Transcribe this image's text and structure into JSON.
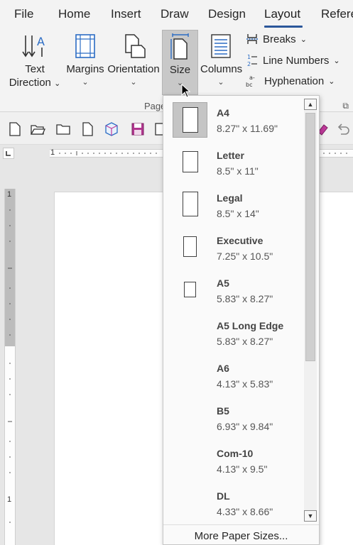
{
  "tabs": [
    {
      "label": "File"
    },
    {
      "label": "Home"
    },
    {
      "label": "Insert"
    },
    {
      "label": "Draw"
    },
    {
      "label": "Design"
    },
    {
      "label": "Layout",
      "active": true
    },
    {
      "label": "Refere"
    }
  ],
  "ribbon": {
    "text_direction": {
      "line1": "Text",
      "line2": "Direction"
    },
    "margins": "Margins",
    "orientation": "Orientation",
    "size": "Size",
    "columns": "Columns",
    "breaks": "Breaks",
    "line_numbers": "Line Numbers",
    "hyphenation": "Hyphenation",
    "group_label": "Page",
    "chevron": "⌄"
  },
  "ruler": {
    "h_mark": "1",
    "v_marks": [
      "1",
      "1"
    ]
  },
  "size_menu": {
    "items": [
      {
        "name": "A4",
        "dims": "8.27\" x 11.69\"",
        "selected": true
      },
      {
        "name": "Letter",
        "dims": "8.5\" x 11\""
      },
      {
        "name": "Legal",
        "dims": "8.5\" x 14\""
      },
      {
        "name": "Executive",
        "dims": "7.25\" x 10.5\""
      },
      {
        "name": "A5",
        "dims": "5.83\" x 8.27\""
      },
      {
        "name": "A5 Long Edge",
        "dims": "5.83\" x 8.27\""
      },
      {
        "name": "A6",
        "dims": "4.13\" x 5.83\""
      },
      {
        "name": "B5",
        "dims": "6.93\" x 9.84\""
      },
      {
        "name": "Com-10",
        "dims": "4.13\" x 9.5\""
      },
      {
        "name": "DL",
        "dims": "4.33\" x 8.66\""
      }
    ],
    "more": "More Paper Sizes..."
  },
  "colors": {
    "accent": "#2b579a",
    "selected_bg": "#c5c5c5",
    "ribbon_bg": "#f3f3f3"
  }
}
